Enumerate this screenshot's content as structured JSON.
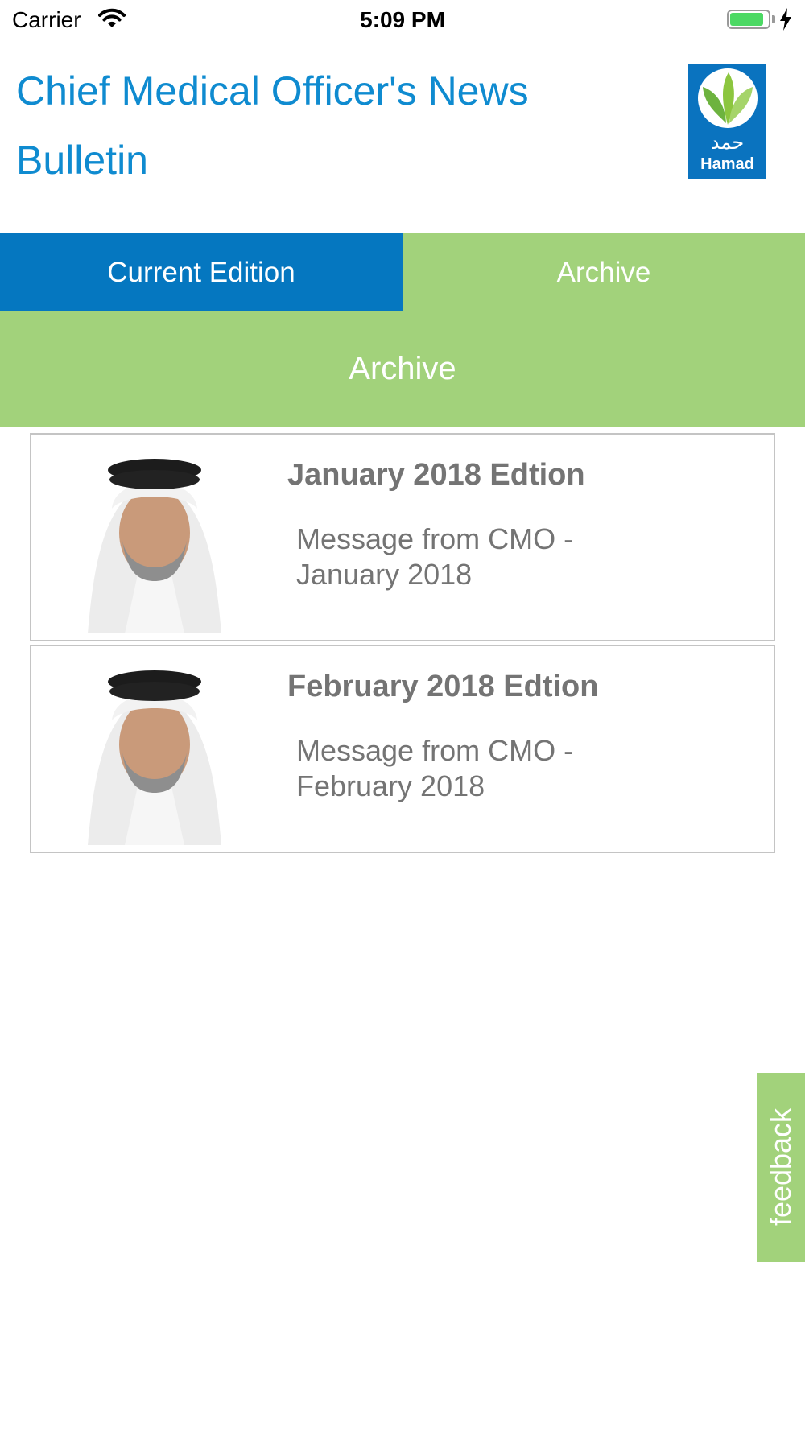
{
  "status_bar": {
    "carrier": "Carrier",
    "time": "5:09 PM",
    "battery_level": 0.9
  },
  "header": {
    "title": "Chief Medical Officer's News Bulletin",
    "logo": {
      "arabic_text": "حمد",
      "text": "Hamad",
      "icon": "leaves-icon"
    }
  },
  "tabs": [
    {
      "label": "Current Edition",
      "selected": true
    },
    {
      "label": "Archive",
      "selected": false
    }
  ],
  "section_title": "Archive",
  "editions": [
    {
      "title": "January 2018 Edtion",
      "message": "Message from CMO - January 2018",
      "thumbnail": "cmo-portrait"
    },
    {
      "title": "February 2018 Edtion",
      "message": "Message from CMO - February 2018",
      "thumbnail": "cmo-portrait"
    }
  ],
  "feedback_label": "feedback",
  "colors": {
    "title_blue": "#0f8bd0",
    "tab_blue": "#0577c0",
    "green": "#a2d27b",
    "text_gray": "#747474",
    "card_border": "#c4c4c4",
    "logo_blue": "#0a73bf"
  }
}
